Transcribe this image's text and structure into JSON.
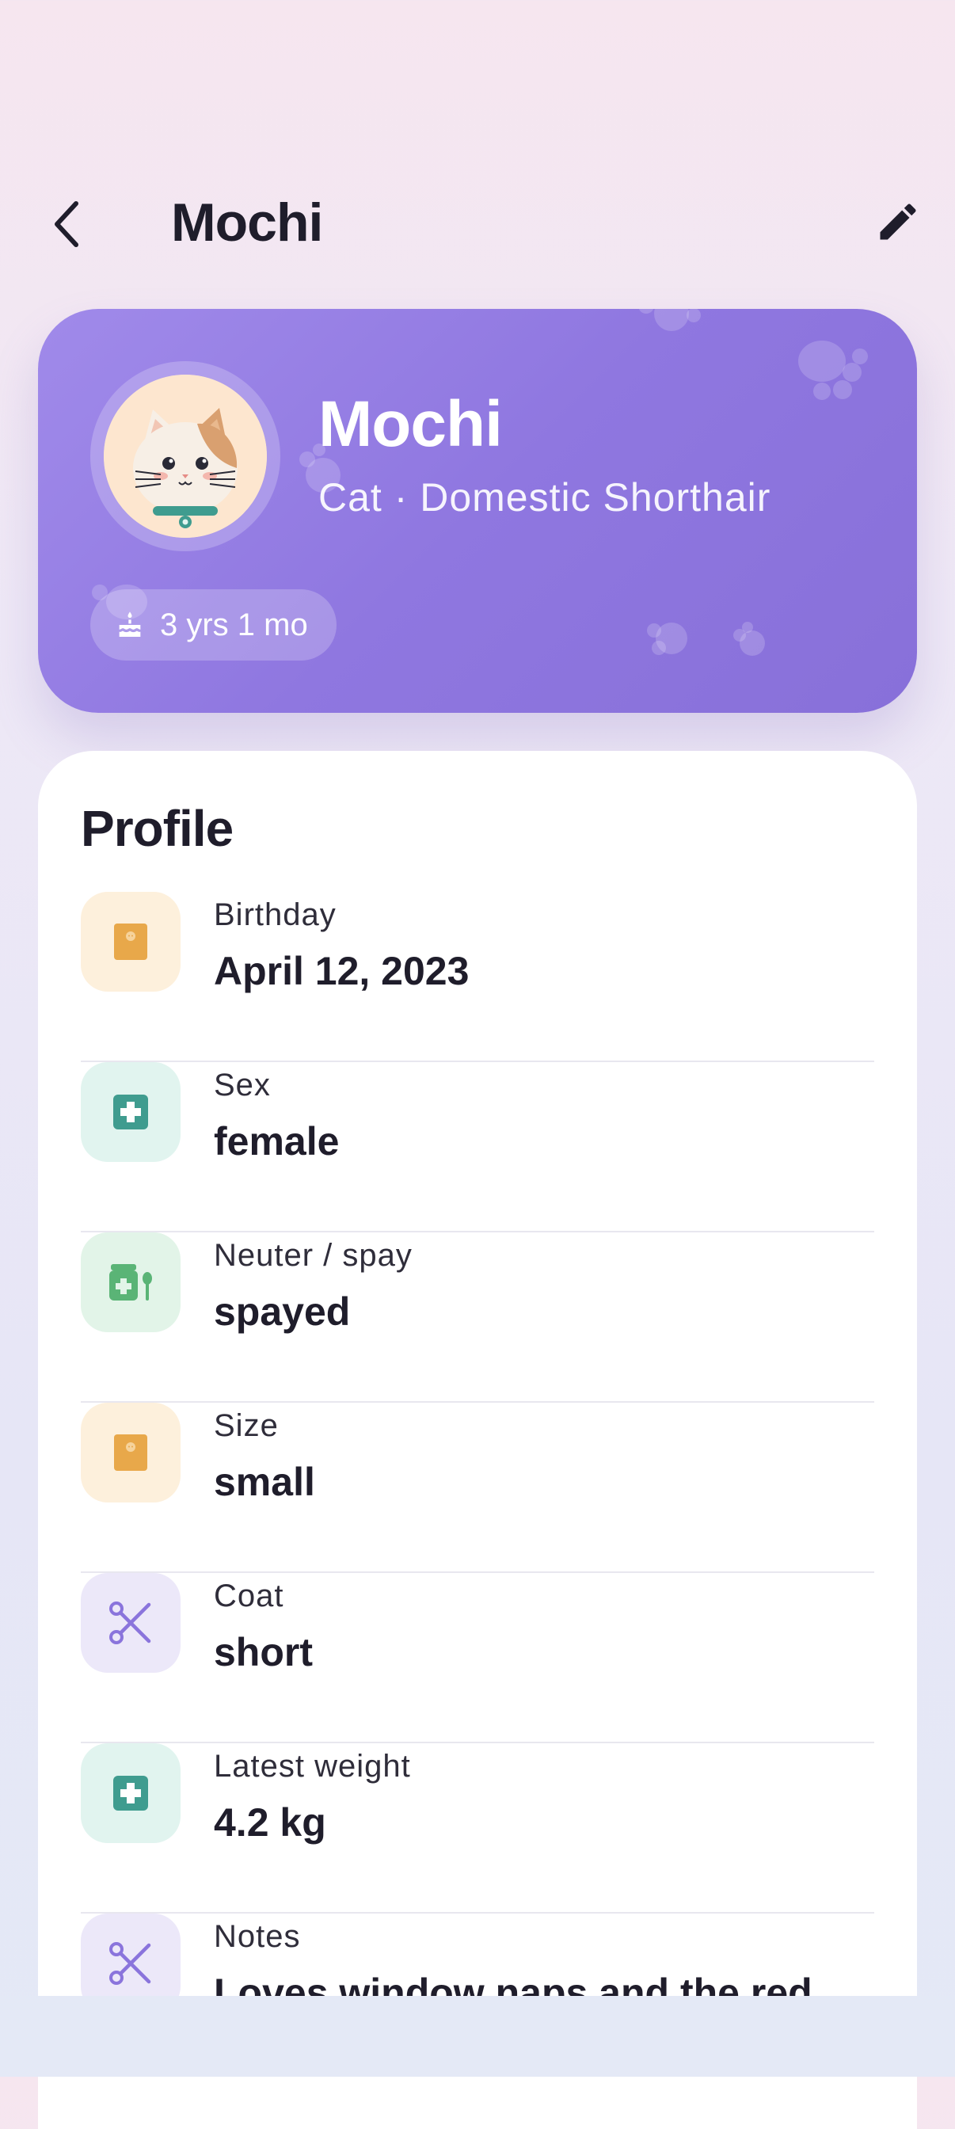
{
  "header": {
    "title": "Mochi",
    "back_icon": "chevron-left-icon",
    "edit_icon": "pencil-icon"
  },
  "hero": {
    "name": "Mochi",
    "subtitle": "Cat · Domestic Shorthair",
    "age": "3 yrs 1 mo",
    "age_icon": "cake-icon",
    "avatar": "cat-avatar-icon",
    "gradient": [
      "#a08aea",
      "#8870d9"
    ]
  },
  "profile": {
    "title": "Profile",
    "rows": [
      {
        "label": "Birthday",
        "value": "April 12, 2023",
        "icon": "food-bag-icon",
        "color": "#e8a84a"
      },
      {
        "label": "Sex",
        "value": "female",
        "icon": "medical-cross-icon",
        "color": "#3f9c8f"
      },
      {
        "label": "Neuter / spay",
        "value": "spayed",
        "icon": "medicine-jar-icon",
        "color": "#5ab476"
      },
      {
        "label": "Size",
        "value": "small",
        "icon": "food-bag-icon",
        "color": "#e8a84a"
      },
      {
        "label": "Coat",
        "value": "short",
        "icon": "scissors-icon",
        "color": "#8a74dc"
      },
      {
        "label": "Latest weight",
        "value": "4.2 kg",
        "icon": "medical-cross-icon",
        "color": "#3f9c8f"
      },
      {
        "label": "Notes",
        "value": "Loves window naps and the red",
        "icon": "scissors-icon",
        "color": "#8a74dc"
      }
    ]
  }
}
